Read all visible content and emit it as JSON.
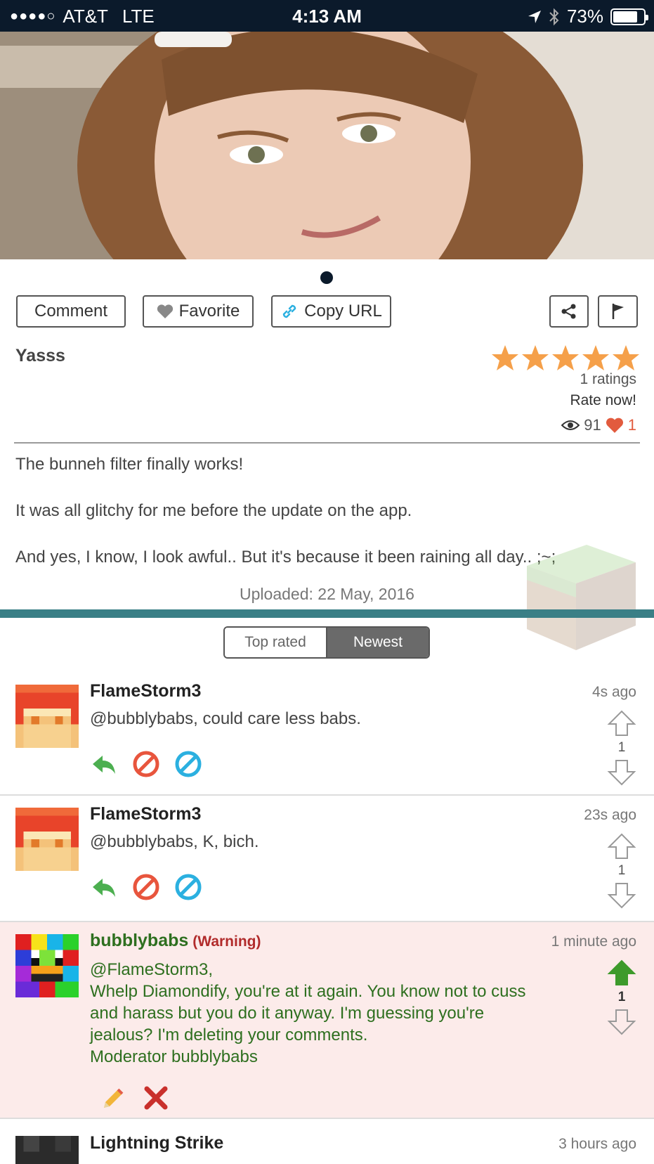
{
  "status_bar": {
    "carrier": "AT&T",
    "network": "LTE",
    "time": "4:13 AM",
    "battery": "73%",
    "signal_dots": "●●●●○",
    "battery_level": 0.73
  },
  "actions": {
    "comment": "Comment",
    "favorite": "Favorite",
    "copy_url": "Copy URL"
  },
  "post": {
    "title": "Yasss",
    "rating_stars": 5,
    "ratings_count": "1 ratings",
    "rate_now": "Rate now!",
    "views": "91",
    "likes": "1",
    "description": [
      "The bunneh filter finally works!",
      "It was all glitchy for me before the update on the app.",
      "And yes, I know, I look awful.. But it's because it been raining all day.. ;~;"
    ],
    "uploaded": "Uploaded: 22 May, 2016"
  },
  "tabs": {
    "top_rated": "Top rated",
    "newest": "Newest",
    "active": "newest"
  },
  "comments": [
    {
      "author": "FlameStorm3",
      "time": "4s ago",
      "text": "@bubblybabs, could care less babs.",
      "score": "1"
    },
    {
      "author": "FlameStorm3",
      "time": "23s ago",
      "text": "@bubblybabs, K, bich.",
      "score": "1"
    },
    {
      "author": "bubblybabs",
      "tag": "(Warning)",
      "time": "1 minute ago",
      "lines": [
        "@FlameStorm3,",
        "Whelp Diamondify, you're at it again. You know not to cuss",
        "and harass but you do it anyway. I'm guessing you're",
        "jealous? I'm deleting your comments.",
        "Moderator bubblybabs"
      ],
      "score": "1"
    },
    {
      "author": "Lightning Strike",
      "time": "3 hours ago"
    }
  ],
  "colors": {
    "status_bar": "#0b1a2b",
    "teal_divider": "#3a7f86",
    "star": "#f5a04a",
    "heart": "#e25b3e",
    "reply_green": "#4caf50",
    "block_red": "#e8553d",
    "block_blue": "#2bb0e0",
    "moderator_green": "#2e6f1f",
    "warning_red": "#b12b2b",
    "warning_bg": "#fcebea"
  }
}
